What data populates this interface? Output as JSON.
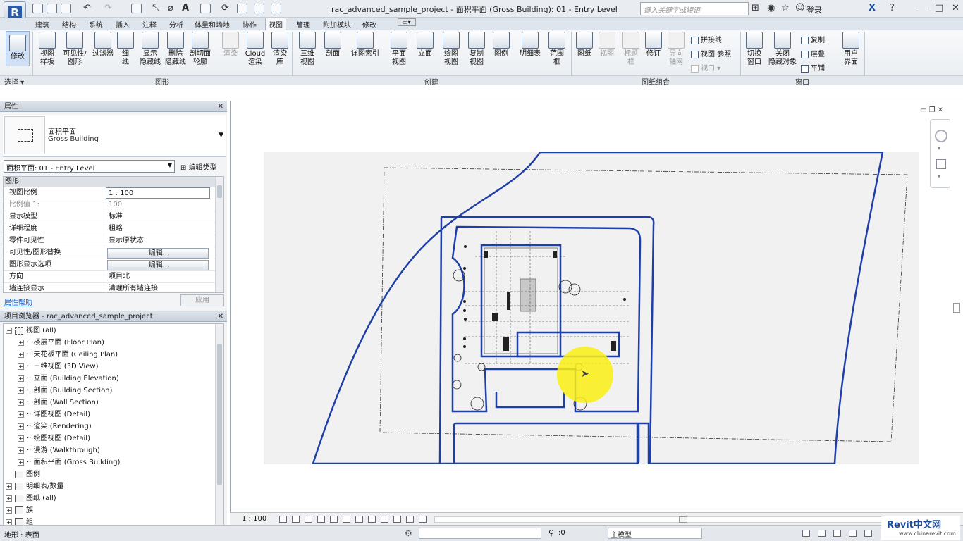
{
  "window": {
    "title": "rac_advanced_sample_project - 面积平面 (Gross Building): 01 - Entry Level",
    "search_placeholder": "键入关键字或短语",
    "sign_in": "登录",
    "app_logo": "R"
  },
  "tabs": [
    "建筑",
    "结构",
    "系统",
    "插入",
    "注释",
    "分析",
    "体量和场地",
    "协作",
    "视图",
    "管理",
    "附加模块",
    "修改"
  ],
  "active_tab": "视图",
  "ribbon": {
    "modify": "修改",
    "select_dropdown": "选择",
    "graphics": {
      "label": "图形",
      "items": [
        "视图\n样板",
        "可见性/\n图形",
        "过滤器",
        "细\n线",
        "显示\n隐藏线",
        "删除\n隐藏线",
        "剖切面\n轮廓"
      ],
      "disabled": [
        "渲染",
        "Cloud\n渲染",
        "渲染\n库"
      ]
    },
    "create": {
      "label": "创建",
      "items": [
        "三维\n视图",
        "剖面",
        "详图索引",
        "平面\n视图",
        "立面",
        "绘图\n视图",
        "复制\n视图",
        "图例",
        "明细表",
        "范围\n框"
      ]
    },
    "sheet": {
      "label": "图纸组合",
      "items": [
        "图纸",
        "视图",
        "标题\n栏",
        "修订",
        "导向\n轴网"
      ],
      "small": [
        "拼接线",
        "视图 参照",
        "视口"
      ]
    },
    "window": {
      "label": "窗口",
      "items": [
        "切换\n窗口",
        "关闭\n隐藏对象"
      ],
      "small": [
        "复制",
        "层叠",
        "平铺"
      ],
      "ui": "用户\n界面"
    }
  },
  "properties": {
    "header": "属性",
    "type_name": "面积平面",
    "type_sub": "Gross Building",
    "instance": "面积平面: 01 - Entry Level",
    "edit_type": "编辑类型",
    "category": "图形",
    "rows": [
      {
        "k": "视图比例",
        "v": "1 : 100"
      },
      {
        "k": "比例值 1:",
        "v": "100"
      },
      {
        "k": "显示模型",
        "v": "标准"
      },
      {
        "k": "详细程度",
        "v": "粗略"
      },
      {
        "k": "零件可见性",
        "v": "显示原状态"
      },
      {
        "k": "可见性/图形替换",
        "v": "编辑..."
      },
      {
        "k": "图形显示选项",
        "v": "编辑..."
      },
      {
        "k": "方向",
        "v": "项目北"
      },
      {
        "k": "墙连接显示",
        "v": "清理所有墙连接"
      }
    ],
    "help": "属性帮助",
    "apply": "应用"
  },
  "project_browser": {
    "header": "项目浏览器 - rac_advanced_sample_project",
    "root": "视图 (all)",
    "children": [
      "楼层平面 (Floor Plan)",
      "天花板平面 (Ceiling Plan)",
      "三维视图 (3D View)",
      "立面 (Building Elevation)",
      "剖面 (Building Section)",
      "剖面 (Wall Section)",
      "详图视图 (Detail)",
      "渲染 (Rendering)",
      "绘图视图 (Detail)",
      "漫游 (Walkthrough)",
      "面积平面 (Gross Building)"
    ],
    "legends": "图例",
    "schedules": "明细表/数量",
    "sheets": "图纸 (all)",
    "families": "族",
    "groups": "组"
  },
  "view_bar": {
    "scale": "1 : 100"
  },
  "status": {
    "left": "地形 : 表面",
    "filter_count": ":0",
    "model": "主模型"
  },
  "watermark": {
    "brand": "Revit中文网",
    "site": "www.chinarevit.com"
  },
  "colors": {
    "accent": "#1f3fa8",
    "ribbon_bg": "#eef1f4",
    "highlight": "#f5ec14"
  }
}
